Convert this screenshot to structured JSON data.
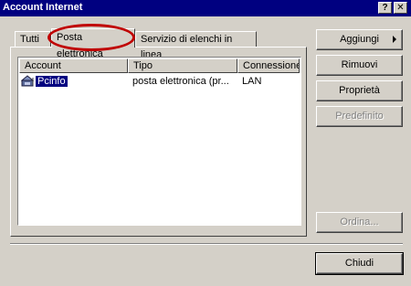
{
  "window": {
    "title": "Account Internet",
    "help_glyph": "?",
    "close_glyph": "✕"
  },
  "tabs": [
    {
      "label": "Tutti",
      "active": false
    },
    {
      "label": "Posta elettronica",
      "active": true
    },
    {
      "label": "Servizio di elenchi in linea",
      "active": false
    }
  ],
  "list": {
    "columns": [
      "Account",
      "Tipo",
      "Connessione"
    ],
    "rows": [
      {
        "account": "Pcinfo",
        "tipo": "posta elettronica (pr...",
        "connessione": "LAN",
        "selected": true
      }
    ]
  },
  "buttons": {
    "add": "Aggiungi",
    "remove": "Rimuovi",
    "properties": "Proprietà",
    "set_default": "Predefinito",
    "order": "Ordina...",
    "close": "Chiudi"
  },
  "colors": {
    "titlebar": "#000080",
    "face": "#d4d0c8",
    "highlight_circle": "#c00000"
  },
  "icons": {
    "account_icon": "mail-account-icon",
    "submenu_arrow": "arrow-right-icon"
  }
}
